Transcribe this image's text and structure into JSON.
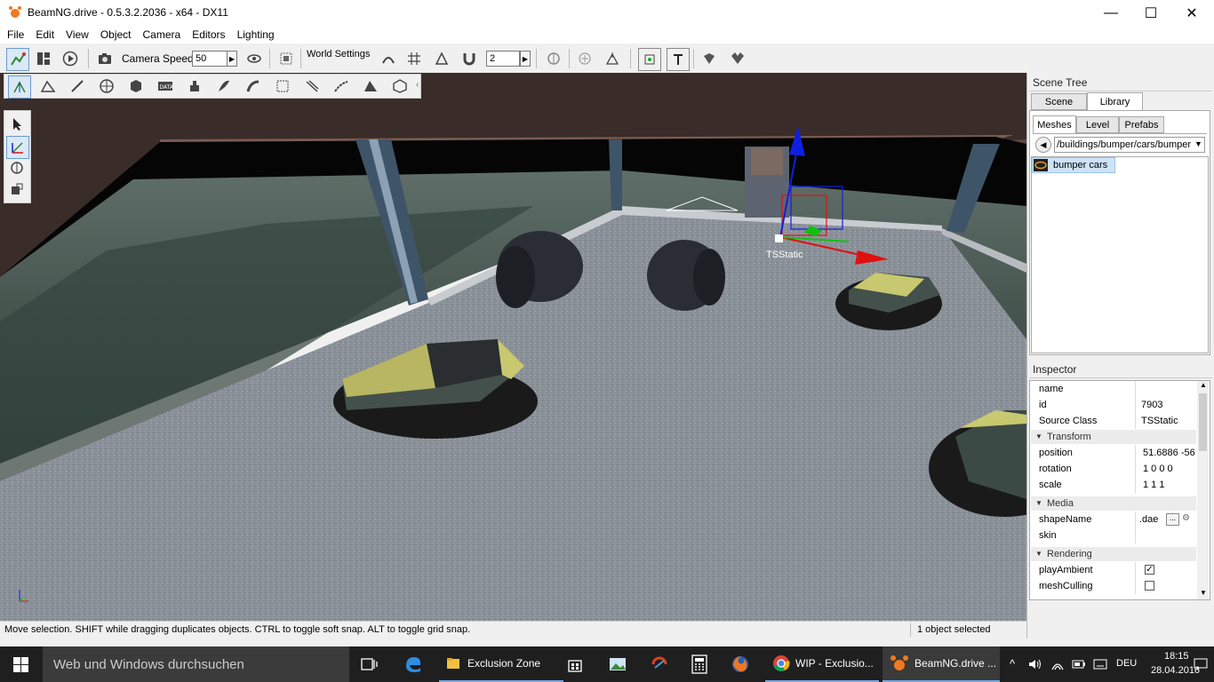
{
  "window": {
    "title": "BeamNG.drive - 0.5.3.2.2036 - x64 - DX11",
    "minimize": "—",
    "maximize": "☐",
    "close": "✕"
  },
  "menu": [
    "File",
    "Edit",
    "View",
    "Object",
    "Camera",
    "Editors",
    "Lighting"
  ],
  "toolbar": {
    "camera_speed_label": "Camera Speed",
    "camera_speed_value": "50",
    "world_settings_label": "World Settings",
    "grid_value": "2"
  },
  "viewport": {
    "selected_label": "TSStatic"
  },
  "status": {
    "message": "Move selection.  SHIFT while dragging duplicates objects.  CTRL to toggle soft snap.  ALT to toggle grid snap.",
    "selection": "1 object selected"
  },
  "scene_tree": {
    "title": "Scene Tree",
    "tabs": [
      "Scene",
      "Library"
    ],
    "active_tab": "Library",
    "subtabs": [
      "Meshes",
      "Level",
      "Prefabs"
    ],
    "path": "/buildings/bumper/cars/bumper",
    "items": [
      {
        "label": "bumper cars"
      }
    ]
  },
  "inspector": {
    "title": "Inspector",
    "fields": [
      {
        "key": "name",
        "value": ""
      },
      {
        "key": "id",
        "value": "7903"
      },
      {
        "key": "Source Class",
        "value": "TSStatic"
      }
    ],
    "transform": {
      "group": "Transform",
      "position": {
        "key": "position",
        "value": "51.6886 -56"
      },
      "rotation": {
        "key": "rotation",
        "value": "1 0 0 0"
      },
      "scale": {
        "key": "scale",
        "value": "1 1 1"
      }
    },
    "media": {
      "group": "Media",
      "shapeName": {
        "key": "shapeName",
        "value": ".dae"
      },
      "skin": {
        "key": "skin",
        "value": ""
      },
      "browse_label": "..."
    },
    "rendering": {
      "group": "Rendering",
      "playAmbient": {
        "key": "playAmbient",
        "checked": true
      },
      "meshCulling": {
        "key": "meshCulling",
        "checked": false
      }
    }
  },
  "taskbar": {
    "search_placeholder": "Web und Windows durchsuchen",
    "tasks": [
      {
        "label": "Exclusion Zone"
      },
      {
        "label": "WIP - Exclusio..."
      },
      {
        "label": "BeamNG.drive ..."
      }
    ],
    "language": "DEU",
    "time": "18:15",
    "date": "28.04.2016"
  },
  "colors": {
    "accent": "#0078d7",
    "taskbar": "#1f1f1f",
    "gizmo_x": "#e01010",
    "gizmo_y": "#10c010",
    "gizmo_z": "#1020e0"
  }
}
